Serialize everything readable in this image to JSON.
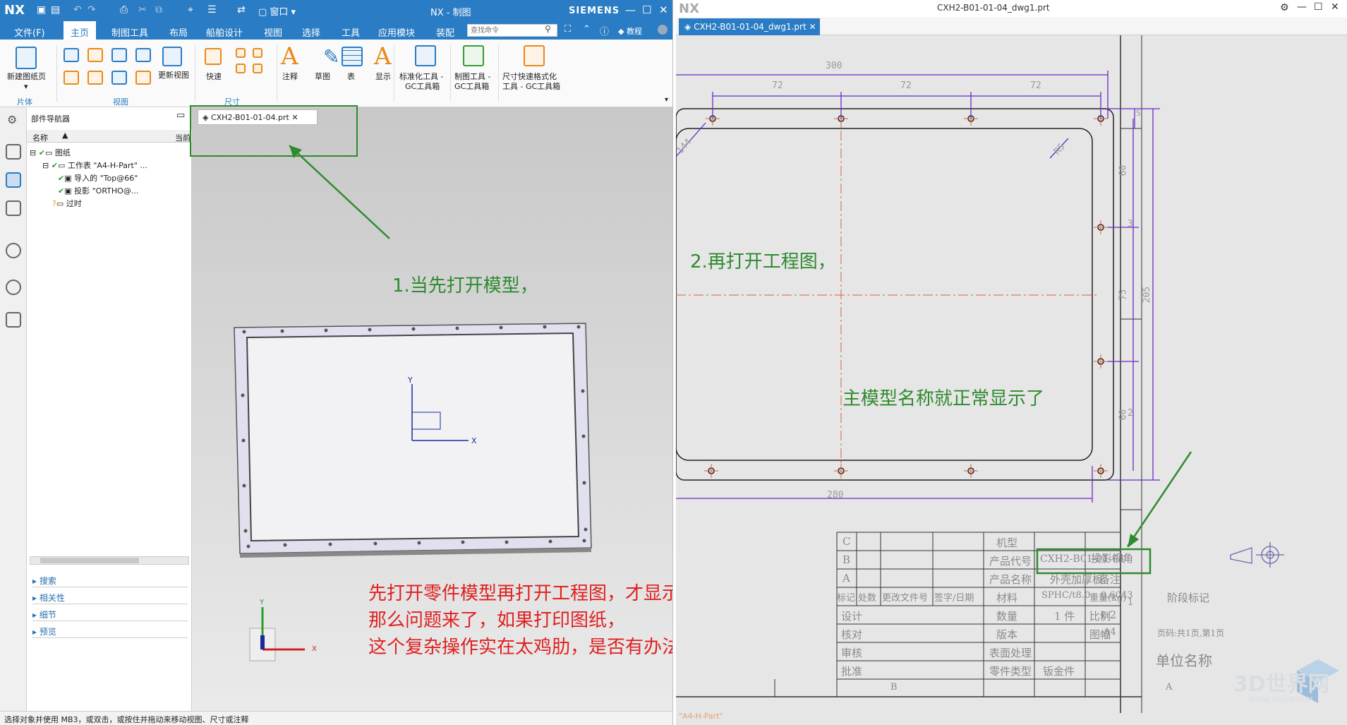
{
  "left": {
    "title": "NX - 制图",
    "brand": "SIEMENS",
    "logo": "NX",
    "menu": [
      "文件(F)",
      "主页",
      "制图工具",
      "布局",
      "船舶设计",
      "视图",
      "选择",
      "工具",
      "应用模块",
      "装配"
    ],
    "search_placeholder": "查找命令",
    "tutorial": "教程",
    "ribbon": {
      "new_sheet": "新建图纸页",
      "update_view": "更新视图",
      "quick": "快速",
      "annotation": "注释",
      "sketch": "草图",
      "table": "表",
      "display": "显示",
      "std_tools_1": "标准化工具 -",
      "std_tools_2": "GC工具箱",
      "draft_tools_1": "制图工具 -",
      "draft_tools_2": "GC工具箱",
      "dim_tools_1": "尺寸快速格式化",
      "dim_tools_2": "工具 - GC工具箱",
      "group_sheet": "片体",
      "group_view": "视图",
      "group_dim": "尺寸"
    },
    "navigator": {
      "title": "部件导航器",
      "col_name": "名称",
      "col_current": "当前",
      "tree": [
        "图纸",
        "工作表 \"A4-H-Part\" ...",
        "导入的 \"Top@66\"",
        "投影 \"ORTHO@...",
        "过时"
      ],
      "sections": [
        "搜索",
        "相关性",
        "细节",
        "预览"
      ]
    },
    "doc_tab": "CXH2-B01-01-04.prt",
    "status": "选择对象并使用 MB3，或双击，或按住并拖动来移动视图、尺寸或注释",
    "annotation_1": "1.当先打开模型，",
    "annotation_red": [
      "先打开零件模型再打开工程图，才显示主模型名，",
      "那么问题来了，如果打印图纸，",
      "这个复杂操作实在太鸡肋，是否有办法解决。"
    ]
  },
  "right": {
    "logo": "NX",
    "title": "CXH2-B01-01-04_dwg1.prt",
    "tab": "CXH2-B01-01-04_dwg1.prt",
    "annotation_2": "2.再打开工程图，",
    "annotation_3": "主模型名称就正常显示了",
    "dims": {
      "d300": "300",
      "d72a": "72",
      "d72b": "72",
      "d72c": "72",
      "d280": "280",
      "d60a": "60",
      "d75": "75",
      "d205": "205",
      "d60b": "60",
      "d5": "5",
      "r5": "R5",
      "d144": "144"
    },
    "border_nums": [
      "3",
      "2",
      "1"
    ],
    "title_block": {
      "rows_left": [
        "C",
        "B",
        "A"
      ],
      "hdr": [
        "标记",
        "处数",
        "更改文件号",
        "签字/日期"
      ],
      "design": "设计",
      "check": "核对",
      "review": "审核",
      "approve": "批准",
      "model_type": "机型",
      "product_code": "产品代号",
      "product_name": "产品名称",
      "material": "材料",
      "quantity": "数量",
      "version": "版本",
      "surface": "表面处理",
      "part_type": "零件类型",
      "code_value": "CXH2-B01-01-04",
      "name_value": "外壳加厚板",
      "material_value": "SPHC/t8.0",
      "qty_value": "1 件",
      "type_value": "钣金件",
      "proj_angle": "投影视角",
      "weight": "重量(kg)",
      "weight_value": "0.6043",
      "remark": "备注",
      "stage": "阶段标记",
      "scale": "比例",
      "scale_value": "1:2",
      "sheet": "图幅",
      "sheet_value": "A4",
      "pages": "页码:共1页,第1页",
      "unit": "单位名称",
      "col_b": "B",
      "col_a": "A"
    },
    "sheet_name": "\"A4-H-Part\"",
    "watermark": "3D世界网",
    "watermark_url": "WWW.3DSJW.COM"
  }
}
